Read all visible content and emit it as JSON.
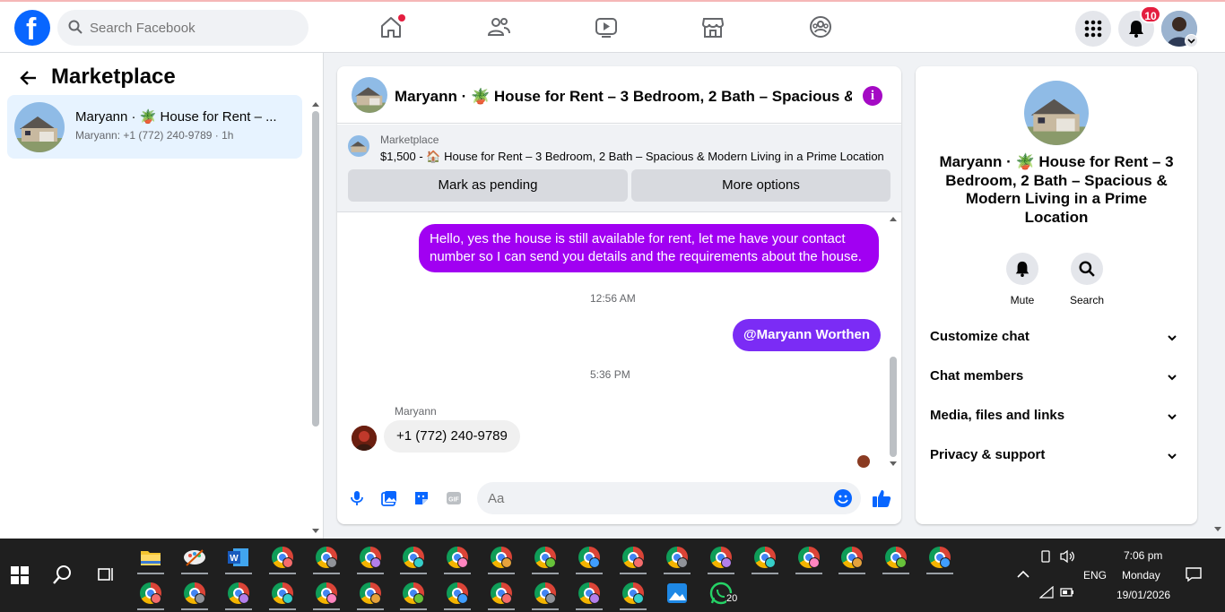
{
  "topnav": {
    "search_placeholder": "Search Facebook",
    "notifications_count": "10"
  },
  "sidebar": {
    "title": "Marketplace",
    "conversation": {
      "name": "Maryann · 🪴 House for Rent – ...",
      "preview": "Maryann: +1 (772) 240-9789 · 1h"
    }
  },
  "chat": {
    "header_title": "Maryann · 🪴 House for Rent – 3 Bedroom, 2 Bath – Spacious & ...",
    "marketplace_label": "Marketplace",
    "listing_line": "$1,500 - 🏠 House for Rent – 3 Bedroom, 2 Bath – Spacious & Modern Living in a Prime Location",
    "mark_pending_label": "Mark as pending",
    "more_options_label": "More options",
    "messages": {
      "outgoing_1": "Hello, yes the house is still available for rent, let me have your contact number so I can send you details and the requirements about the house.",
      "time_1": "12:56 AM",
      "outgoing_2": "@Maryann Worthen",
      "time_2": "5:36 PM",
      "incoming_sender": "Maryann",
      "incoming_1": "+1 (772) 240-9789"
    },
    "composer_placeholder": "Aa"
  },
  "details": {
    "title": "Maryann · 🪴 House for Rent – 3 Bedroom, 2 Bath – Spacious & Modern Living in a Prime Location",
    "mute_label": "Mute",
    "search_label": "Search",
    "sections": [
      "Customize chat",
      "Chat members",
      "Media, files and links",
      "Privacy & support"
    ]
  },
  "taskbar": {
    "lang": "ENG",
    "time": "7:06 pm",
    "day": "Monday",
    "date": "19/01/2026",
    "whatsapp_count": "20"
  },
  "colors": {
    "brand": "#0866ff",
    "outgoing_bubble": "#a100f2",
    "mention_bubble": "#7b2cf5"
  }
}
